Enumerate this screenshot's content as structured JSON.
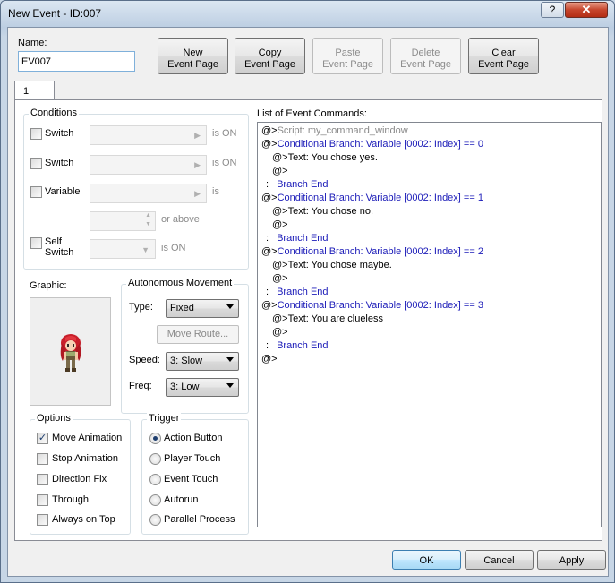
{
  "window": {
    "title": "New Event - ID:007",
    "help_label": "?",
    "close_label": "✕"
  },
  "event": {
    "name_label": "Name:",
    "name_value": "EV007"
  },
  "page_buttons": {
    "new_line1": "New",
    "new_line2": "Event Page",
    "copy_line1": "Copy",
    "copy_line2": "Event Page",
    "paste_line1": "Paste",
    "paste_line2": "Event Page",
    "delete_line1": "Delete",
    "delete_line2": "Event Page",
    "clear_line1": "Clear",
    "clear_line2": "Event Page"
  },
  "tabs": [
    {
      "label": "1"
    }
  ],
  "conditions": {
    "title": "Conditions",
    "switch1_label": "Switch",
    "switch1_suffix": "is ON",
    "switch2_label": "Switch",
    "switch2_suffix": "is ON",
    "variable_label": "Variable",
    "variable_suffix": "is",
    "variable_or_above": "or above",
    "self_switch_label_1": "Self",
    "self_switch_label_2": "Switch",
    "self_switch_suffix": "is ON"
  },
  "graphic": {
    "label": "Graphic:"
  },
  "autonomous": {
    "title": "Autonomous Movement",
    "type_label": "Type:",
    "type_value": "Fixed",
    "move_route_label": "Move Route...",
    "speed_label": "Speed:",
    "speed_value": "3: Slow",
    "freq_label": "Freq:",
    "freq_value": "3: Low"
  },
  "options": {
    "title": "Options",
    "items": [
      {
        "label": "Move Animation",
        "checked": true
      },
      {
        "label": "Stop Animation",
        "checked": false
      },
      {
        "label": "Direction Fix",
        "checked": false
      },
      {
        "label": "Through",
        "checked": false
      },
      {
        "label": "Always on Top",
        "checked": false
      }
    ]
  },
  "trigger": {
    "title": "Trigger",
    "items": [
      {
        "label": "Action Button",
        "selected": true
      },
      {
        "label": "Player Touch",
        "selected": false
      },
      {
        "label": "Event Touch",
        "selected": false
      },
      {
        "label": "Autorun",
        "selected": false
      },
      {
        "label": "Parallel Process",
        "selected": false
      }
    ]
  },
  "commands": {
    "title": "List of Event Commands:",
    "lines": [
      {
        "prefix": "@>",
        "text": "Script: my_command_window",
        "color": "grey"
      },
      {
        "prefix": "@>",
        "text": "Conditional Branch: Variable [0002: Index] == 0",
        "color": "blue"
      },
      {
        "prefix": "@>",
        "text": "Text: You chose yes.",
        "color": "black"
      },
      {
        "prefix": "@>",
        "text": "",
        "color": "black"
      },
      {
        "prefix": ":",
        "text": "Branch End",
        "color": "blue"
      },
      {
        "prefix": "@>",
        "text": "Conditional Branch: Variable [0002: Index] == 1",
        "color": "blue"
      },
      {
        "prefix": "@>",
        "text": "Text: You chose no.",
        "color": "black"
      },
      {
        "prefix": "@>",
        "text": "",
        "color": "black"
      },
      {
        "prefix": ":",
        "text": "Branch End",
        "color": "blue"
      },
      {
        "prefix": "@>",
        "text": "Conditional Branch: Variable [0002: Index] == 2",
        "color": "blue"
      },
      {
        "prefix": "@>",
        "text": "Text: You chose maybe.",
        "color": "black"
      },
      {
        "prefix": "@>",
        "text": "",
        "color": "black"
      },
      {
        "prefix": ":",
        "text": "Branch End",
        "color": "blue"
      },
      {
        "prefix": "@>",
        "text": "Conditional Branch: Variable [0002: Index] == 3",
        "color": "blue"
      },
      {
        "prefix": "@>",
        "text": "Text: You are clueless",
        "color": "black"
      },
      {
        "prefix": "@>",
        "text": "",
        "color": "black"
      },
      {
        "prefix": ":",
        "text": "Branch End",
        "color": "blue"
      },
      {
        "prefix": "@>",
        "text": "",
        "color": "black"
      }
    ]
  },
  "footer": {
    "ok_label": "OK",
    "cancel_label": "Cancel",
    "apply_label": "Apply"
  }
}
